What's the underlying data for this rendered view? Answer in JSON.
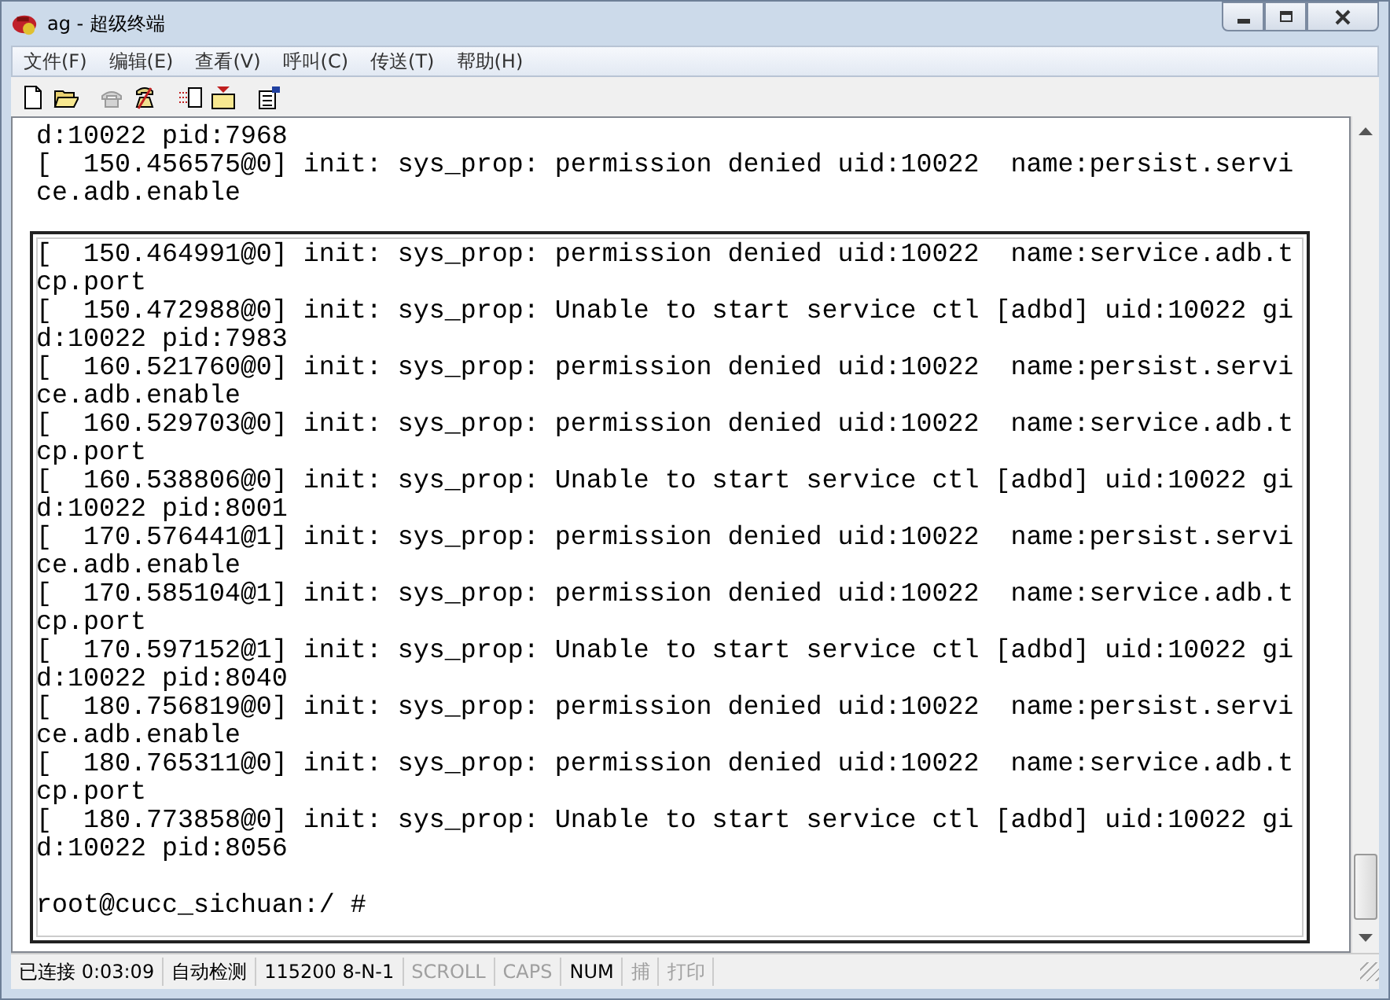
{
  "window": {
    "title": "ag - 超级终端"
  },
  "menu": [
    "文件(F)",
    "编辑(E)",
    "查看(V)",
    "呼叫(C)",
    "传送(T)",
    "帮助(H)"
  ],
  "toolbar": [
    {
      "kind": "new",
      "disabled": false
    },
    {
      "kind": "open",
      "disabled": false
    },
    {
      "kind": "call",
      "disabled": true
    },
    {
      "kind": "hangup",
      "disabled": false
    },
    {
      "kind": "send",
      "disabled": false
    },
    {
      "kind": "receive",
      "disabled": false
    },
    {
      "kind": "properties",
      "disabled": false
    }
  ],
  "terminal": {
    "scrollback": [
      "d:10022 pid:7968",
      "[  150.456575@0] init: sys_prop: permission denied uid:10022  name:persist.servi",
      "ce.adb.enable"
    ],
    "lines": [
      "[  150.464991@0] init: sys_prop: permission denied uid:10022  name:service.adb.t",
      "cp.port",
      "[  150.472988@0] init: sys_prop: Unable to start service ctl [adbd] uid:10022 gi",
      "d:10022 pid:7983",
      "[  160.521760@0] init: sys_prop: permission denied uid:10022  name:persist.servi",
      "ce.adb.enable",
      "[  160.529703@0] init: sys_prop: permission denied uid:10022  name:service.adb.t",
      "cp.port",
      "[  160.538806@0] init: sys_prop: Unable to start service ctl [adbd] uid:10022 gi",
      "d:10022 pid:8001",
      "[  170.576441@1] init: sys_prop: permission denied uid:10022  name:persist.servi",
      "ce.adb.enable",
      "[  170.585104@1] init: sys_prop: permission denied uid:10022  name:service.adb.t",
      "cp.port",
      "[  170.597152@1] init: sys_prop: Unable to start service ctl [adbd] uid:10022 gi",
      "d:10022 pid:8040",
      "[  180.756819@0] init: sys_prop: permission denied uid:10022  name:persist.servi",
      "ce.adb.enable",
      "[  180.765311@0] init: sys_prop: permission denied uid:10022  name:service.adb.t",
      "cp.port",
      "[  180.773858@0] init: sys_prop: Unable to start service ctl [adbd] uid:10022 gi",
      "d:10022 pid:8056"
    ],
    "prompt": "root@cucc_sichuan:/ #"
  },
  "status_bar": [
    {
      "text": "已连接 0:03:09",
      "on": true
    },
    {
      "text": "自动检测",
      "on": true
    },
    {
      "text": "115200 8-N-1",
      "on": true
    },
    {
      "text": "SCROLL",
      "on": false
    },
    {
      "text": "CAPS",
      "on": false
    },
    {
      "text": "NUM",
      "on": true
    },
    {
      "text": "捕",
      "on": false
    },
    {
      "text": "打印",
      "on": false
    }
  ]
}
